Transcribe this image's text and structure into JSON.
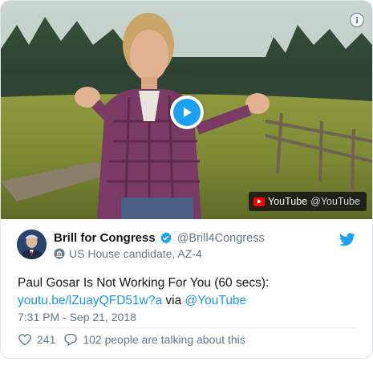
{
  "video": {
    "source_badge": {
      "brand": "YouTube",
      "handle": "@YouTube"
    },
    "play_icon": "play-icon",
    "info_icon": "info-icon"
  },
  "author": {
    "display_name": "Brill for Congress",
    "screen_name": "@Brill4Congress",
    "label": "US House candidate, AZ-4",
    "verified": true
  },
  "tweet": {
    "text": "Paul Gosar Is Not Working For You (60 secs):",
    "link": "youtu.be/lZuayQFD51w?a",
    "via_word": "via",
    "mention": "@YouTube",
    "timestamp": "7:31 PM - Sep 21, 2018"
  },
  "actions": {
    "likes": "241",
    "talking": "102 people are talking about this"
  },
  "colors": {
    "accent": "#1da1f2",
    "link": "#1b95e0",
    "muted": "#657786",
    "border": "#e1e8ed",
    "youtube_red": "#ff0000"
  }
}
